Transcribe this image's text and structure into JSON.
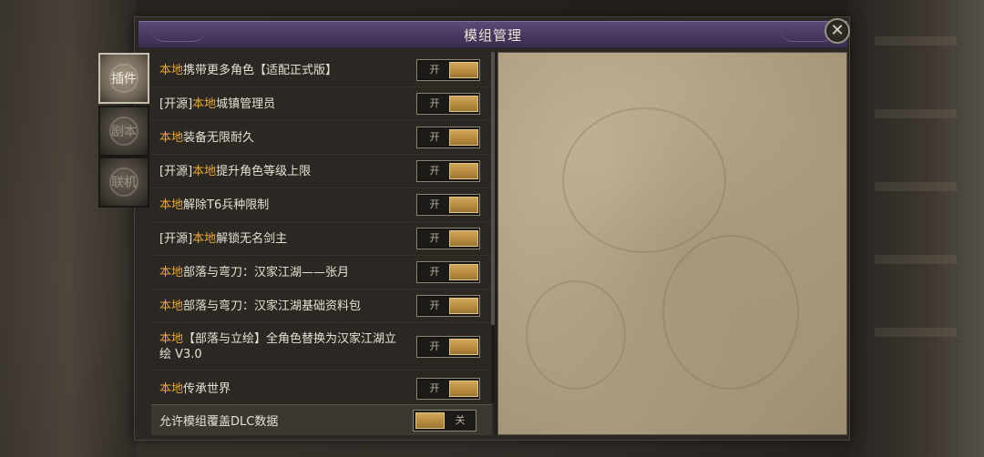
{
  "window": {
    "title": "模组管理",
    "close_icon_glyph": "✕"
  },
  "tabs": [
    {
      "label": "插件",
      "active": true
    },
    {
      "label": "剧本",
      "active": false
    },
    {
      "label": "联机",
      "active": false
    }
  ],
  "mods": [
    {
      "prefix": "",
      "highlight": "本地",
      "name": "携带更多角色【适配正式版】",
      "state": "开",
      "on": true
    },
    {
      "prefix": "[开源]",
      "highlight": "本地",
      "name": "城镇管理员",
      "state": "开",
      "on": true
    },
    {
      "prefix": "",
      "highlight": "本地",
      "name": "装备无限耐久",
      "state": "开",
      "on": true
    },
    {
      "prefix": "[开源]",
      "highlight": "本地",
      "name": "提升角色等级上限",
      "state": "开",
      "on": true
    },
    {
      "prefix": "",
      "highlight": "本地",
      "name": "解除T6兵种限制",
      "state": "开",
      "on": true
    },
    {
      "prefix": "[开源]",
      "highlight": "本地",
      "name": "解锁无名剑主",
      "state": "开",
      "on": true
    },
    {
      "prefix": "",
      "highlight": "本地",
      "name": "部落与弯刀：汉家江湖——张月",
      "state": "开",
      "on": true
    },
    {
      "prefix": "",
      "highlight": "本地",
      "name": "部落与弯刀：汉家江湖基础资料包",
      "state": "开",
      "on": true
    },
    {
      "prefix": "",
      "highlight": "本地",
      "name": "【部落与立绘】全角色替换为汉家江湖立绘 V3.0",
      "state": "开",
      "on": true
    },
    {
      "prefix": "",
      "highlight": "本地",
      "name": "传承世界",
      "state": "开",
      "on": true
    }
  ],
  "footer": {
    "label": "允许模组覆盖DLC数据",
    "state": "关",
    "on": false
  },
  "colors": {
    "highlight": "#e7a63a",
    "title_bar": "#47385f",
    "toggle_knob": "#b58a3e"
  }
}
